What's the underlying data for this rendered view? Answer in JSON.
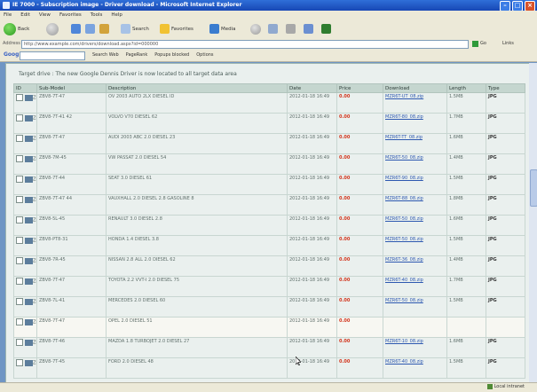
{
  "window": {
    "title": "IE 7000 - Subscription image - Driver download - Microsoft Internet Explorer"
  },
  "menu": [
    "File",
    "Edit",
    "View",
    "Favorites",
    "Tools",
    "Help"
  ],
  "toolbar": {
    "back": "Back",
    "search": "Search",
    "favorites": "Favorites",
    "media": "Media"
  },
  "address": {
    "label": "Address",
    "value": "http://www.example.com/drivers/download.aspx?id=000000",
    "go": "Go",
    "links": "Links"
  },
  "google": {
    "logo": "Google",
    "items": [
      "Search Web",
      "PageRank",
      "Popups blocked",
      "Options"
    ]
  },
  "page": {
    "notice": "Target drive : The new Google Dennis Driver is now located to all target data area",
    "columns": [
      "ID",
      "Sub-Model",
      "Description",
      "Date",
      "Price",
      "Download",
      "Length",
      "Type"
    ]
  },
  "rows": [
    {
      "id": "ZBC",
      "model": "ZBV8-7T-47",
      "desc": "OV 2003 AUTO 2LX DIESEL ID",
      "date": "2012-01-18 16:49",
      "price": "0.00",
      "dl": "MZR6T-UT_08.zip",
      "len": "1.5MB",
      "type": "JPG"
    },
    {
      "id": "ZBV",
      "model": "ZBV8-7T-41 42",
      "desc": "VOLVO V70 DIESEL 62",
      "date": "2012-01-18 16:49",
      "price": "0.00",
      "dl": "MZR6T-80_08.zip",
      "len": "1.7MB",
      "type": "JPG"
    },
    {
      "id": "ZBC",
      "model": "ZBV8-7T-47",
      "desc": "AUDI 2003 ABC 2.0 DIESEL 23",
      "date": "2012-01-18 16:49",
      "price": "0.00",
      "dl": "MZR6T-TT_08.zip",
      "len": "1.6MB",
      "type": "JPG"
    },
    {
      "id": "ZBC",
      "model": "ZBV8-7M-45",
      "desc": "VW PASSAT 2.0 DIESEL 54",
      "date": "2012-01-18 16:49",
      "price": "0.00",
      "dl": "MZR6T-50_08.zip",
      "len": "1.4MB",
      "type": "JPG"
    },
    {
      "id": "ZBC",
      "model": "ZBV8-7T-44",
      "desc": "SEAT 3.0 DIESEL 61",
      "date": "2012-01-18 16:49",
      "price": "0.00",
      "dl": "MZR6T-90_08.zip",
      "len": "1.5MB",
      "type": "JPG"
    },
    {
      "id": "ZBC",
      "model": "ZBV8-7T-47 44",
      "desc": "VAUXHALL 2.0 DIESEL 2.8 GASOLINE 8",
      "date": "2012-01-18 16:49",
      "price": "0.00",
      "dl": "MZR6T-88_08.zip",
      "len": "1.8MB",
      "type": "JPG"
    },
    {
      "id": "ZBC",
      "model": "ZBV8-5L-45",
      "desc": "RENAULT 3.0 DIESEL 2.8",
      "date": "2012-01-18 16:49",
      "price": "0.00",
      "dl": "MZR6T-50_08.zip",
      "len": "1.6MB",
      "type": "JPG"
    },
    {
      "id": "ZBV",
      "model": "ZBV8-PT8-31",
      "desc": "HONDA 1.4 DIESEL 3.8",
      "date": "2012-01-18 16:49",
      "price": "0.00",
      "dl": "MZR6T-50_08.zip",
      "len": "1.5MB",
      "type": "JPG"
    },
    {
      "id": "ZBC",
      "model": "ZBV8-7R-45",
      "desc": "NISSAN 2.8 ALL 2.0 DIESEL 62",
      "date": "2012-01-18 16:49",
      "price": "0.00",
      "dl": "MZR6T-36_08.zip",
      "len": "1.4MB",
      "type": "JPG"
    },
    {
      "id": "ZBC",
      "model": "ZBV8-7T-47",
      "desc": "TOYOTA 2.2 VVT-I 2.0 DIESEL 75",
      "date": "2012-01-18 16:49",
      "price": "0.00",
      "dl": "MZR6T-40_08.zip",
      "len": "1.7MB",
      "type": "JPG"
    },
    {
      "id": "ZBC",
      "model": "ZBV8-7L-41",
      "desc": "MERCEDES 2.0 DIESEL 60",
      "date": "2012-01-18 16:49",
      "price": "0.00",
      "dl": "MZR6T-50_08.zip",
      "len": "1.5MB",
      "type": "JPG"
    },
    {
      "id": "ZBC",
      "model": "ZBV8-7T-47",
      "desc": "OPEL 2.0 DIESEL 51",
      "date": "2012-01-18 16:49",
      "price": "0.00",
      "dl": "",
      "len": "",
      "type": ""
    },
    {
      "id": "ZBC",
      "model": "ZBV8-7T-46",
      "desc": "MAZDA 1.8 TURBOJET 2.0 DIESEL 27",
      "date": "2012-01-18 16:49",
      "price": "0.00",
      "dl": "MZR6T-10_08.zip",
      "len": "1.6MB",
      "type": "JPG"
    },
    {
      "id": "ZBC",
      "model": "ZBV8-7T-45",
      "desc": "FORD 2.0 DIESEL 48",
      "date": "2012-01-18 16:49",
      "price": "0.00",
      "dl": "MZR6T-40_08.zip",
      "len": "1.5MB",
      "type": "JPG"
    }
  ],
  "status": {
    "zone": "Local intranet"
  }
}
